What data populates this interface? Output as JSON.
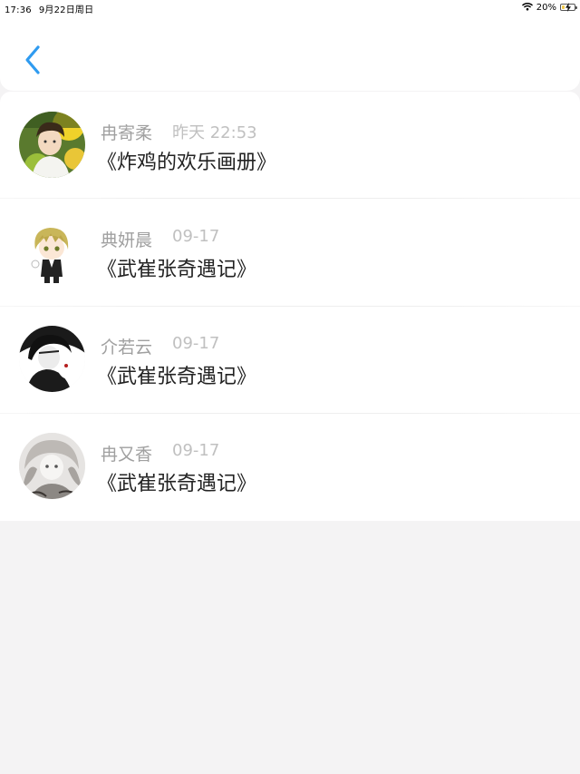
{
  "status_bar": {
    "time": "17:36",
    "date": "9月22日周日",
    "battery_text": "20%",
    "battery_level": 0.2,
    "icons": [
      "wifi-icon",
      "battery-icon",
      "charging-bolt-icon"
    ]
  },
  "header": {
    "back_icon": "chevron-left-icon",
    "accent_color": "#2f9bf0"
  },
  "items": [
    {
      "name": "冉寄柔",
      "time": "昨天 22:53",
      "title": "《炸鸡的欢乐画册》"
    },
    {
      "name": "典妍晨",
      "time": "09-17",
      "title": "《武崔张奇遇记》"
    },
    {
      "name": "介若云",
      "time": "09-17",
      "title": "《武崔张奇遇记》"
    },
    {
      "name": "冉又香",
      "time": "09-17",
      "title": "《武崔张奇遇记》"
    }
  ],
  "colors": {
    "background": "#f4f3f4",
    "card": "#ffffff",
    "name": "#a0a0a0",
    "time": "#c0c0c0",
    "title": "#222222"
  }
}
